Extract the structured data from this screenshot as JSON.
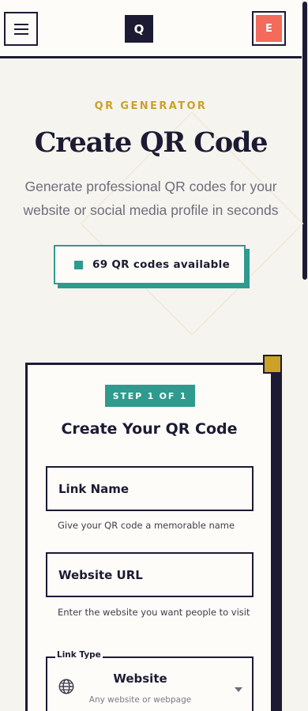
{
  "header": {
    "logo_letter": "Q",
    "avatar_initial": "E"
  },
  "hero": {
    "eyebrow": "QR GENERATOR",
    "title": "Create QR Code",
    "subtitle": "Generate professional QR codes for your website or social media profile in seconds",
    "availability": "69 QR codes available"
  },
  "form": {
    "step_badge": "STEP 1 OF 1",
    "title": "Create Your QR Code",
    "link_name": {
      "placeholder": "Link Name",
      "helper": "Give your QR code a memorable name"
    },
    "website_url": {
      "placeholder": "Website URL",
      "helper": "Enter the website you want people to visit"
    },
    "link_type": {
      "label": "Link Type",
      "value": "Website",
      "description": "Any website or webpage"
    }
  },
  "colors": {
    "accent_teal": "#2f9a8e",
    "accent_gold": "#c9a227",
    "ink": "#1c1b33",
    "avatar": "#f26b5b"
  },
  "icons": [
    "menu-icon",
    "globe-icon",
    "chevron-down-icon"
  ]
}
